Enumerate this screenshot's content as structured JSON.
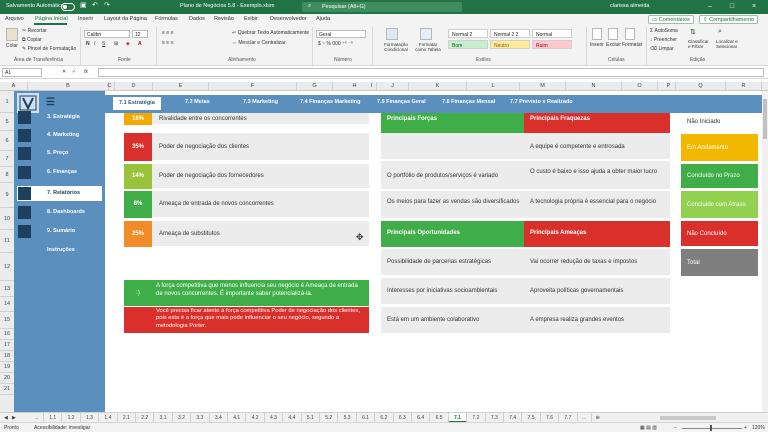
{
  "titlebar": {
    "autosave": "Salvamento Automático",
    "filename": "Plano de Negócios 5.8 - Exemplo.xlsm",
    "search_placeholder": "Pesquisar (Alt+G)",
    "user": "clarissa almeida",
    "minimize": "–",
    "maximize": "□",
    "close": "×"
  },
  "menu": {
    "items": [
      "Arquivo",
      "Página Inicial",
      "Inserir",
      "Layout da Página",
      "Fórmulas",
      "Dados",
      "Revisão",
      "Exibir",
      "Desenvolvedor",
      "Ajuda"
    ],
    "comments": "Comentários",
    "share": "Compartilhamento"
  },
  "ribbon": {
    "paste": "Colar",
    "cut": "Recortar",
    "copy": "Copiar",
    "format_painter": "Pincel de Formatação",
    "group_clipboard": "Área de Transferência",
    "font_name": "Calibri",
    "font_size": "12",
    "bold": "N",
    "italic": "I",
    "underline": "S",
    "group_font": "Fonte",
    "wrap_text": "Quebrar Texto Automaticamente",
    "merge_center": "Mesclar e Centralizar",
    "group_alignment": "Alinhamento",
    "number_format": "Geral",
    "group_number": "Número",
    "conditional_format": "Formatação Condicional",
    "format_table": "Formatar como Tabela",
    "styles": [
      {
        "label": "Normal 2",
        "bg": "#ffffff",
        "fg": "#222222"
      },
      {
        "label": "Normal 2 2",
        "bg": "#ffffff",
        "fg": "#222222"
      },
      {
        "label": "Normal",
        "bg": "#ffffff",
        "fg": "#222222"
      },
      {
        "label": "Bom",
        "bg": "#c6efce",
        "fg": "#006100"
      },
      {
        "label": "Neutro",
        "bg": "#ffeb9c",
        "fg": "#9c5700"
      },
      {
        "label": "Ruim",
        "bg": "#ffc7ce",
        "fg": "#9c0006"
      }
    ],
    "group_styles": "Estilos",
    "insert": "Inserir",
    "delete": "Excluir",
    "format": "Formatar",
    "group_cells": "Células",
    "autosum": "AutoSoma",
    "fill": "Preencher",
    "clear": "Limpar",
    "sort_filter": "Classificar e Filtrar",
    "find_select": "Localizar e Selecionar",
    "group_editing": "Edição"
  },
  "formula_bar": {
    "name_box": "A1",
    "fx": "fx",
    "value": ""
  },
  "columns": [
    "A",
    "B",
    "C",
    "D",
    "E",
    "F",
    "G",
    "H",
    "I",
    "J",
    "K",
    "L",
    "M",
    "N",
    "O",
    "P",
    "Q",
    "R"
  ],
  "rows": [
    "1",
    "5",
    "6",
    "7",
    "8",
    "9",
    "10",
    "11",
    "12",
    "13",
    "14",
    "15",
    "16",
    "17",
    "18",
    "19",
    "20",
    "21"
  ],
  "sidebar": {
    "items": [
      {
        "label": "3. Estratégia"
      },
      {
        "label": "4. Marketing"
      },
      {
        "label": "5. Preço"
      },
      {
        "label": "6. Finanças"
      },
      {
        "label": "7. Relatórios"
      },
      {
        "label": "8. Dashboards"
      },
      {
        "label": "9. Sumário"
      },
      {
        "label": "Instruções"
      }
    ]
  },
  "page_tabs": [
    "7.1 Estratégia",
    "7.2 Metas",
    "7.3 Marketing",
    "7.4 Finanças Marketing",
    "7.5 Finanças Geral",
    "7.6 Finanças Mensal",
    "7.7 Previsto x Realizado"
  ],
  "forces": [
    {
      "pct": "18%",
      "label": "Rivalidade entre os concorrentes",
      "color": "#f2a900"
    },
    {
      "pct": "35%",
      "label": "Poder de negociação dos clientes",
      "color": "#d9302c"
    },
    {
      "pct": "14%",
      "label": "Poder de negociação dos fornecedores",
      "color": "#9ac33c"
    },
    {
      "pct": "8%",
      "label": "Ameaça de entrada de novos concorrentes",
      "color": "#3fae49"
    },
    {
      "pct": "25%",
      "label": "Ameaça de substitutos",
      "color": "#f28c28"
    }
  ],
  "messages": {
    "smile": ":)",
    "green_text": "A força competitiva que menos influencia seu negócio é Ameaça de entrada de novos concorrentes. É importante saber potencializá-la.",
    "red_text": "Você precisa ficar atento à força competitiva Poder de negociação dos clientes, pois esta é a força que mais pode influenciar o seu negócio, segundo a metodologia Porter."
  },
  "swot": {
    "strengths_title": "Principais Forças",
    "weaknesses_title": "Principais Fraquezas",
    "opportunities_title": "Principais Oportunidades",
    "threats_title": "Principais Ameaças",
    "strengths": [
      "",
      "",
      "O portfólio de produtos/serviços é variado",
      "Os meios para fazer as vendas são diversificados"
    ],
    "weaknesses": [
      "",
      "A equipe é competente e entrosada",
      "O custo é baixo e isso ajuda a obter maior lucro",
      "A tecnologia própria é essencial para o negócio"
    ],
    "opportunities": [
      "Possibilidade de parcerias estratégicas",
      "Interesses por iniciativas socioambientais",
      "Está em um ambiente colaborativo"
    ],
    "threats": [
      "Vai ocorrer redução de taxas e impostos",
      "Aproveita políticas governamentais",
      "A empresa realiza grandes eventos"
    ]
  },
  "status_legend": [
    {
      "label": "Não Iniciado",
      "bg": "#ffffff",
      "fg": "#333333"
    },
    {
      "label": "Em Andamento",
      "bg": "#f2b800",
      "fg": "#ffffff"
    },
    {
      "label": "Concluído no Prazo",
      "bg": "#3fae49",
      "fg": "#ffffff"
    },
    {
      "label": "Concluído com Atraso",
      "bg": "#92d050",
      "fg": "#ffffff"
    },
    {
      "label": "Não Concluído",
      "bg": "#d9302c",
      "fg": "#ffffff"
    },
    {
      "label": "Total",
      "bg": "#7f7f7f",
      "fg": "#ffffff"
    }
  ],
  "sheet_tabs": [
    "...",
    "1.1",
    "1.2",
    "1.3",
    "1.4",
    "2.1",
    "2.2",
    "3.1",
    "3.2",
    "3.3",
    "3.4",
    "4.1",
    "4.2",
    "4.3",
    "4.4",
    "5.1",
    "5.2",
    "5.3",
    "6.1",
    "6.2",
    "6.3",
    "6.4",
    "6.5",
    "7.1",
    "7.2",
    "7.3",
    "7.4",
    "7.5",
    "7.6",
    "7.7",
    "..."
  ],
  "statusbar": {
    "ready": "Pronto",
    "accessibility": "Acessibilidade: investigar",
    "zoom": "120%"
  }
}
